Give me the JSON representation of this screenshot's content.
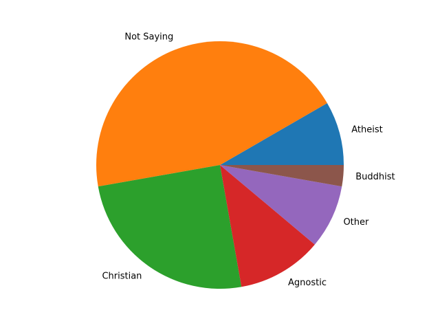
{
  "chart_data": {
    "type": "pie",
    "title": "",
    "start_angle_deg": 0,
    "direction": "counterclockwise",
    "slices": [
      {
        "label": "Atheist",
        "value": 8.33,
        "color": "#1f77b4"
      },
      {
        "label": "Not Saying",
        "value": 44.44,
        "color": "#ff7f0e"
      },
      {
        "label": "Christian",
        "value": 25.0,
        "color": "#2ca02c"
      },
      {
        "label": "Agnostic",
        "value": 11.11,
        "color": "#d62728"
      },
      {
        "label": "Other",
        "value": 8.33,
        "color": "#9467bd"
      },
      {
        "label": "Buddhist",
        "value": 2.78,
        "color": "#8c564b"
      }
    ]
  }
}
